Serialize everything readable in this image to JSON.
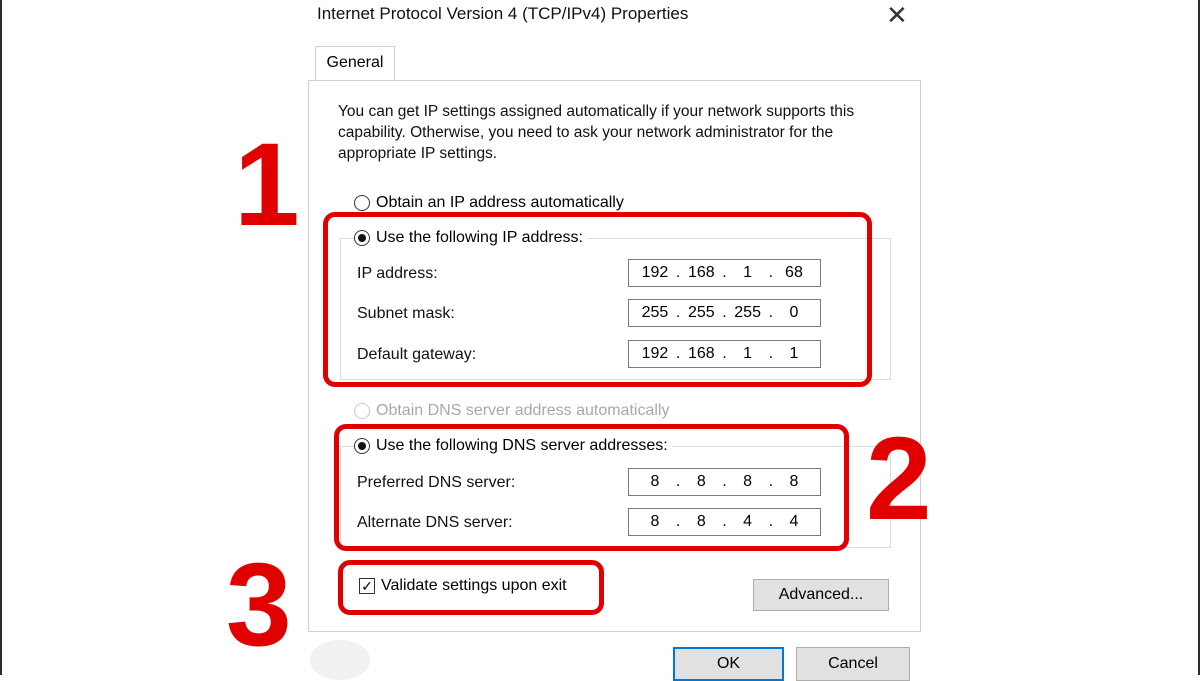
{
  "dialog": {
    "title": "Internet Protocol Version 4 (TCP/IPv4) Properties",
    "close_icon": "✕",
    "tab": "General",
    "description": "You can get IP settings assigned automatically if your network supports this capability. Otherwise, you need to ask your network administrator for the appropriate IP settings."
  },
  "ip_section": {
    "auto_label": "Obtain an IP address automatically",
    "manual_label": "Use the following IP address:",
    "fields": [
      {
        "label": "IP address:",
        "octets": [
          "192",
          "168",
          "1",
          "68"
        ]
      },
      {
        "label": "Subnet mask:",
        "octets": [
          "255",
          "255",
          "255",
          "0"
        ]
      },
      {
        "label": "Default gateway:",
        "octets": [
          "192",
          "168",
          "1",
          "1"
        ]
      }
    ]
  },
  "dns_section": {
    "auto_label": "Obtain DNS server address automatically",
    "manual_label": "Use the following DNS server addresses:",
    "fields": [
      {
        "label": "Preferred DNS server:",
        "octets": [
          "8",
          "8",
          "8",
          "8"
        ]
      },
      {
        "label": "Alternate DNS server:",
        "octets": [
          "8",
          "8",
          "4",
          "4"
        ]
      }
    ]
  },
  "validate_label": "Validate settings upon exit",
  "validate_check": "✓",
  "buttons": {
    "advanced": "Advanced...",
    "ok": "OK",
    "cancel": "Cancel"
  },
  "annotations": {
    "n1": "1",
    "n2": "2",
    "n3": "3"
  },
  "colors": {
    "highlight": "#e00000",
    "focus": "#0078d7"
  }
}
